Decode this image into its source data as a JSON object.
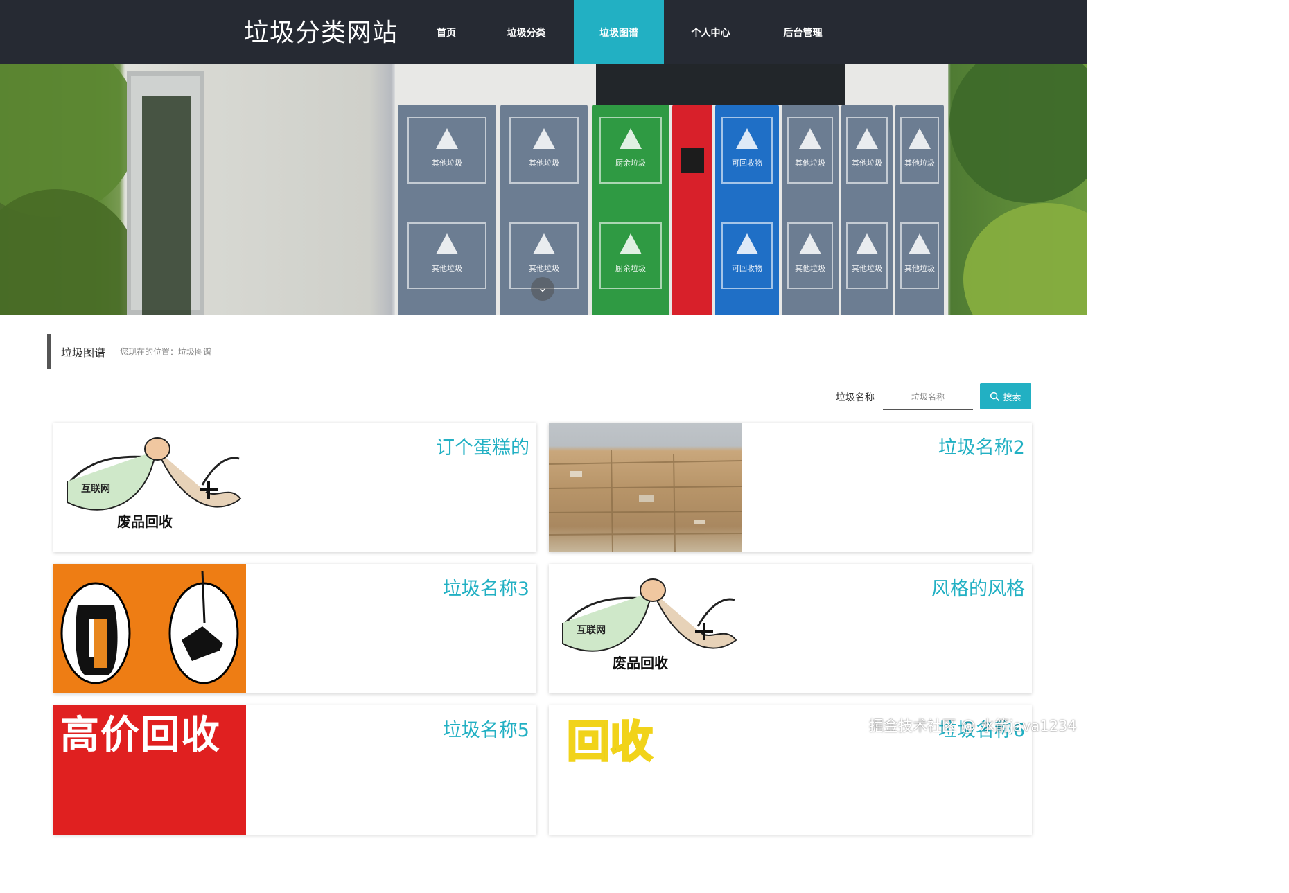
{
  "header": {
    "site_title": "垃圾分类网站",
    "nav": [
      {
        "label": "首页",
        "active": false
      },
      {
        "label": "垃圾分类",
        "active": false
      },
      {
        "label": "垃圾图谱",
        "active": true
      },
      {
        "label": "个人中心",
        "active": false
      },
      {
        "label": "后台管理",
        "active": false
      }
    ],
    "accent": "#22b0c3",
    "bg": "#262a33"
  },
  "banner": {
    "bins": [
      {
        "label": "其他垃圾",
        "color": "#6c7d92"
      },
      {
        "label": "其他垃圾",
        "color": "#6c7d92"
      },
      {
        "label": "厨余垃圾",
        "color": "#2f9a43"
      },
      {
        "label": "",
        "color": "#d8202a"
      },
      {
        "label": "可回收物",
        "color": "#1f6fc6"
      },
      {
        "label": "其他垃圾",
        "color": "#6c7d92"
      },
      {
        "label": "其他垃圾",
        "color": "#6c7d92"
      },
      {
        "label": "其他垃圾",
        "color": "#6c7d92"
      }
    ],
    "scroll_icon": "chevron-down-icon"
  },
  "breadcrumb": {
    "title": "垃圾图谱",
    "path": "您现在的位置：垃圾图谱"
  },
  "search": {
    "label": "垃圾名称",
    "placeholder": "垃圾名称",
    "button": "搜索",
    "icon": "search-icon"
  },
  "items": [
    {
      "name": "订个蛋糕的",
      "image": "internet-recycling-logo"
    },
    {
      "name": "垃圾名称2",
      "image": "cardboard-bales-photo"
    },
    {
      "name": "垃圾名称3",
      "image": "clothes-shoes-recycling"
    },
    {
      "name": "风格的风格",
      "image": "internet-recycling-logo"
    },
    {
      "name": "垃圾名称5",
      "image": "high-price-recycling-sign",
      "image_text": "高价回收"
    },
    {
      "name": "垃圾名称6",
      "image": "recycling-sign-yellow",
      "image_text": "回收"
    }
  ],
  "logo_text": {
    "tag": "互联网",
    "caption": "废品回收"
  },
  "watermark": "掘金技术社区 @ 水箭java1234"
}
